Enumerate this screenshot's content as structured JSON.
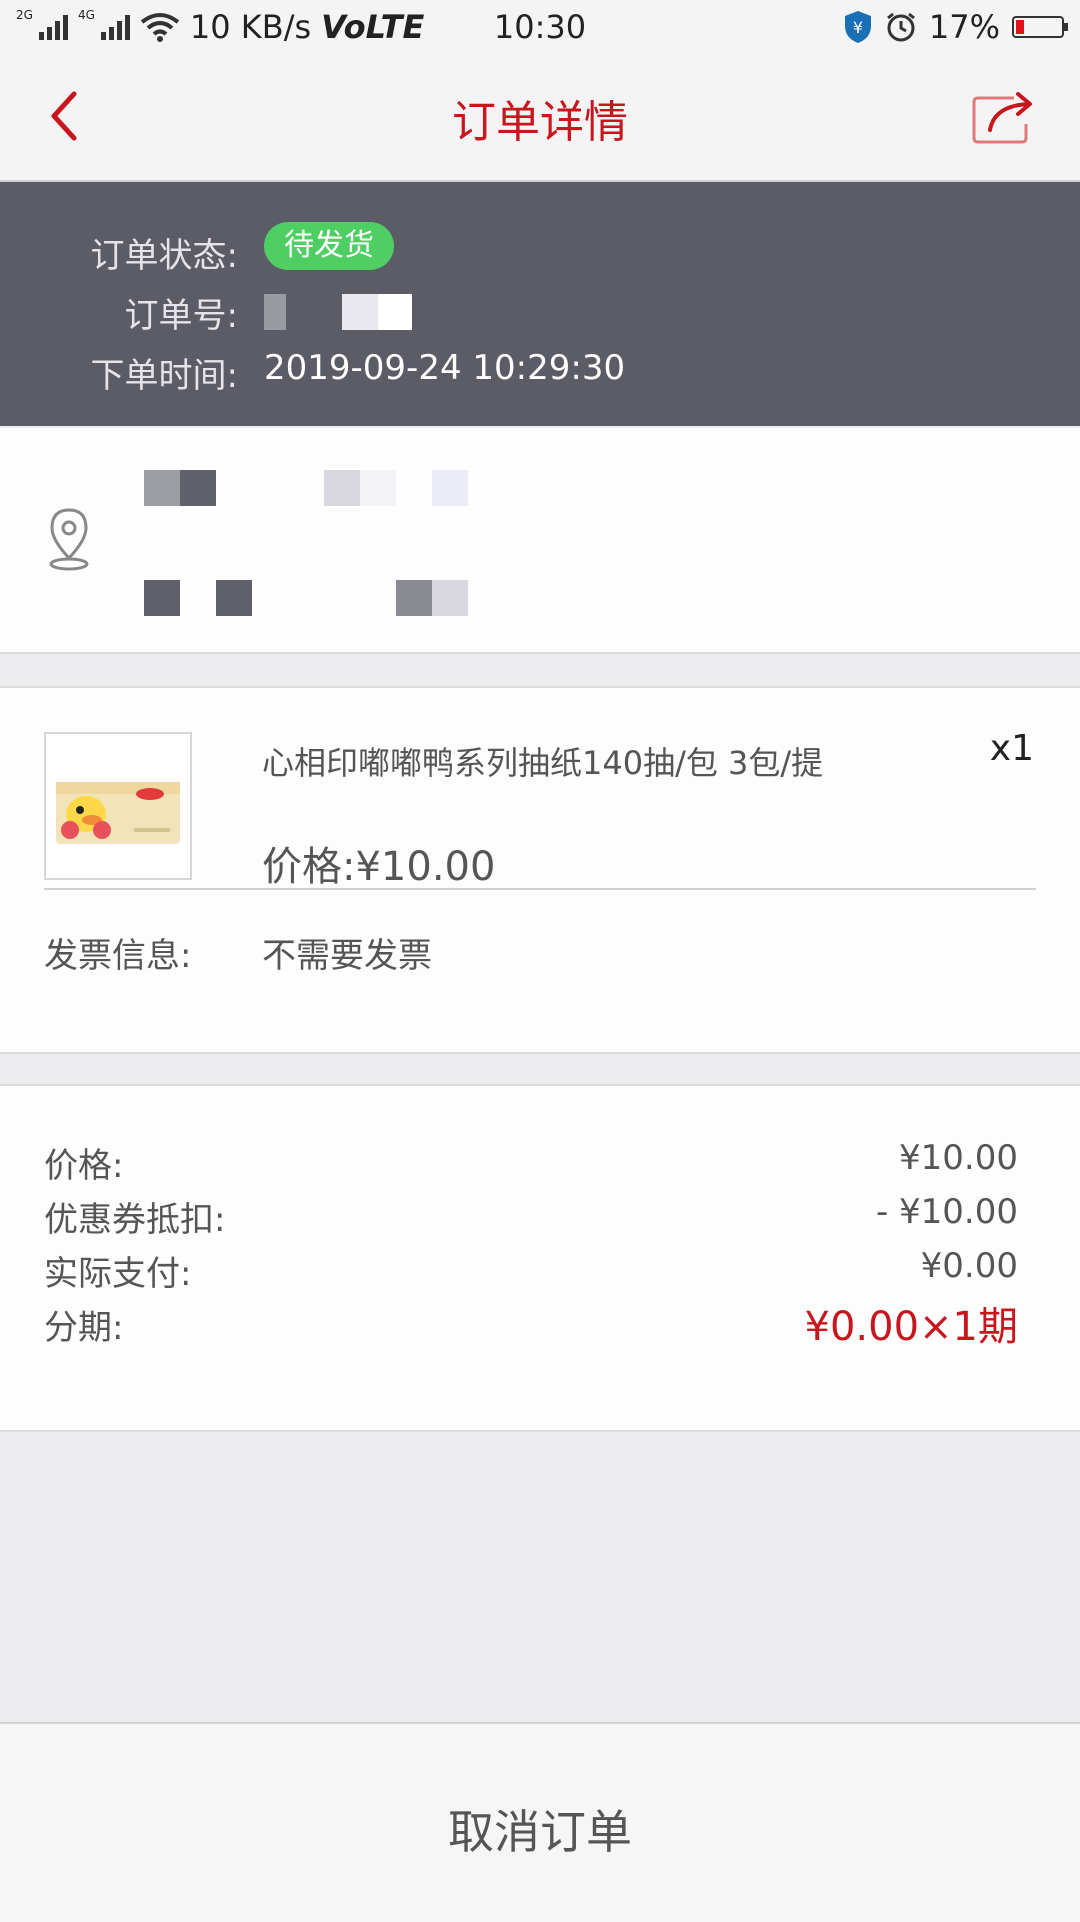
{
  "status_bar": {
    "net_small_1": "2G",
    "net_small_2": "4G",
    "speed": "10 KB/s",
    "volte": "VoLTE",
    "time": "10:30",
    "battery": "17%"
  },
  "nav": {
    "title": "订单详情"
  },
  "order": {
    "status_label": "订单状态:",
    "status_value": "待发货",
    "number_label": "订单号:",
    "time_label": "下单时间:",
    "time_value": "2019-09-24 10:29:30"
  },
  "product": {
    "name": "心相印嘟嘟鸭系列抽纸140抽/包 3包/提",
    "quantity": "x1",
    "price": "价格:¥10.00"
  },
  "invoice": {
    "label": "发票信息:",
    "value": "不需要发票"
  },
  "pricing": [
    {
      "label": "价格:",
      "value": "¥10.00"
    },
    {
      "label": "优惠券抵扣:",
      "value": "- ¥10.00"
    },
    {
      "label": "实际支付:",
      "value": "¥0.00"
    },
    {
      "label": "分期:",
      "value": "¥0.00×1期"
    }
  ],
  "bottom": {
    "cancel_label": "取消订单"
  },
  "colors": {
    "accent_red": "#c8161d",
    "header_bg": "#5b5c66",
    "status_green": "#4fcf63"
  },
  "icons": {
    "back": "chevron-left-icon",
    "share": "share-icon",
    "location": "location-pin-icon"
  }
}
